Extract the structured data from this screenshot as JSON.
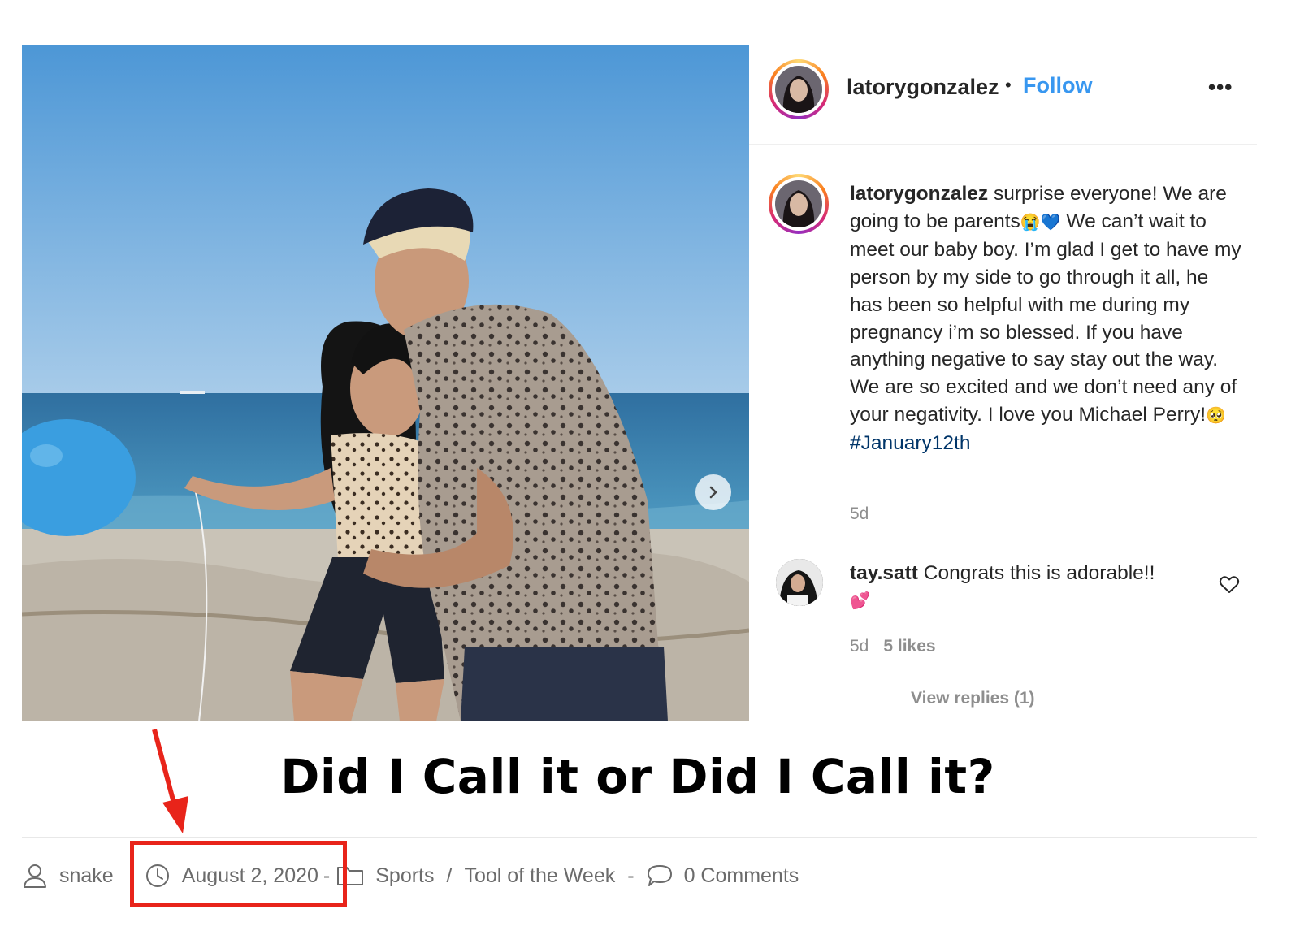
{
  "instagram": {
    "username": "latorygonzalez",
    "separator": "•",
    "follow_label": "Follow",
    "more_label": "•••",
    "caption": {
      "user": "latorygonzalez",
      "text_1": " surprise everyone! We are going to be parents",
      "emoji_1": "😭💙",
      "text_2": " We can’t wait to meet our baby boy. I’m glad I get to have my person by my side to go through it all, he has been so helpful with me during my pregnancy i’m so blessed. If you have anything negative to say stay out the way. We are so excited and we don’t need any of your negativity. I love you Michael Perry!",
      "emoji_2": "🥺",
      "hashtag": "#January12th"
    },
    "post_age": "5d",
    "comment": {
      "user": "tay.satt",
      "text": " Congrats this is adorable!!",
      "emoji": "💕",
      "age": "5d",
      "likes": "5 likes",
      "view_replies": "View replies (1)"
    }
  },
  "headline": "Did I Call it or Did I Call it?",
  "meta": {
    "author": "snake",
    "date": "August 2, 2020",
    "dash": "-",
    "category_1": "Sports",
    "category_sep": "/",
    "category_2": "Tool of the Week",
    "comments": "0 Comments"
  },
  "colors": {
    "follow_blue": "#3897f0",
    "hashtag_navy": "#003569",
    "highlight_red": "#e8241a",
    "muted_gray": "#8e8e8e"
  },
  "icons": [
    "chevron-right-icon",
    "more-dots-icon",
    "heart-icon",
    "user-icon",
    "clock-icon",
    "folder-icon",
    "comment-icon",
    "red-arrow-icon"
  ]
}
